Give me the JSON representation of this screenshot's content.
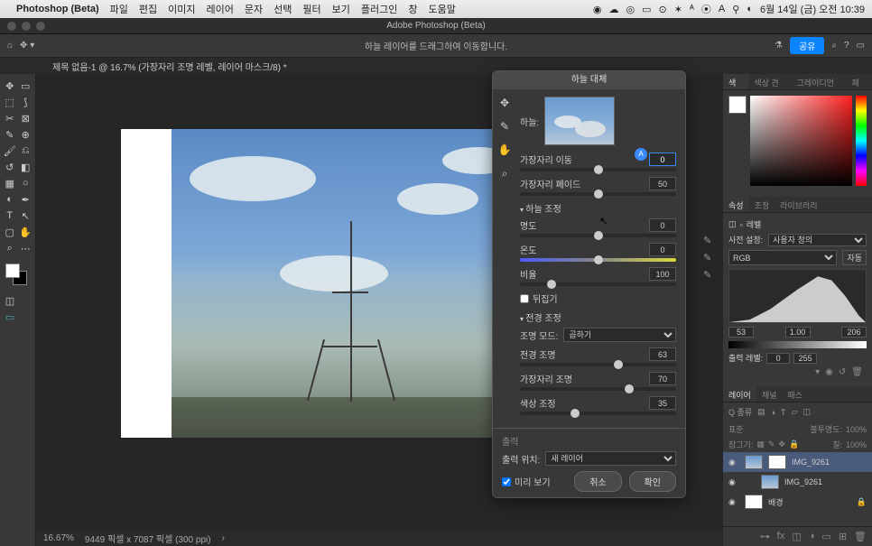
{
  "menubar": {
    "app": "Photoshop (Beta)",
    "items": [
      "파일",
      "편집",
      "이미지",
      "레이어",
      "문자",
      "선택",
      "필터",
      "보기",
      "플러그인",
      "창",
      "도움말"
    ],
    "clock": "6월 14일 (금) 오전 10:39"
  },
  "titlebar": {
    "text": "Adobe Photoshop (Beta)"
  },
  "optionsbar": {
    "hint": "하늘 레이어를 드래그하여 이동합니다.",
    "share": "공유"
  },
  "tab": {
    "label": "제목 없음-1 @ 16.7% (가장자리 조명 레벨, 레이어 마스크/8) *"
  },
  "status": {
    "zoom": "16.67%",
    "docinfo": "9449 픽셀 x 7087 픽셀 (300 ppi)"
  },
  "dialog": {
    "title": "하늘 대체",
    "sky_label": "하늘:",
    "edge_shift": {
      "label": "가장자리 이동",
      "value": "0",
      "pos": 50
    },
    "edge_fade": {
      "label": "가장자리 페이드",
      "value": "50",
      "pos": 50
    },
    "section_sky": "하늘 조정",
    "brightness": {
      "label": "명도",
      "value": "0",
      "pos": 50
    },
    "temperature": {
      "label": "온도",
      "value": "0",
      "pos": 50
    },
    "scale": {
      "label": "비율",
      "value": "100",
      "pos": 20
    },
    "flip": "뒤집기",
    "section_fg": "전경 조정",
    "light_mode_label": "조명 모드:",
    "light_mode_value": "곱하기",
    "fg_light": {
      "label": "전경 조명",
      "value": "63",
      "pos": 63
    },
    "edge_light": {
      "label": "가장자리 조명",
      "value": "70",
      "pos": 70
    },
    "color_adj": {
      "label": "색상 조정",
      "value": "35",
      "pos": 35
    },
    "output_section": "출력",
    "output_to_label": "출력 위치:",
    "output_to_value": "새 레이어",
    "preview": "미리 보기",
    "cancel": "취소",
    "ok": "확인",
    "badge": "A"
  },
  "panels": {
    "color_tabs": [
      "색상",
      "색상 견본",
      "그레이디언트",
      "패턴"
    ],
    "props_tabs": [
      "속성",
      "조정",
      "라이브러리"
    ],
    "props_title": "레벨",
    "preset_label": "사전 설정:",
    "preset_value": "사용자 정의",
    "channel_value": "RGB",
    "auto": "자동",
    "levels": {
      "black": "53",
      "mid": "1.00",
      "white": "206"
    },
    "output_label": "출력 레벨:",
    "output": {
      "black": "0",
      "white": "255"
    },
    "layers_tabs": [
      "레이어",
      "채널",
      "패스"
    ],
    "search_placeholder": "종류",
    "blend_mode": "표준",
    "opacity_label": "불투명도:",
    "opacity_value": "100%",
    "lock_label": "잠그기:",
    "fill_label": "칠:",
    "fill_value": "100%",
    "layers": [
      {
        "name": "IMG_9261",
        "selected": true
      },
      {
        "name": "IMG_9261",
        "selected": false
      },
      {
        "name": "배경",
        "selected": false
      }
    ]
  }
}
